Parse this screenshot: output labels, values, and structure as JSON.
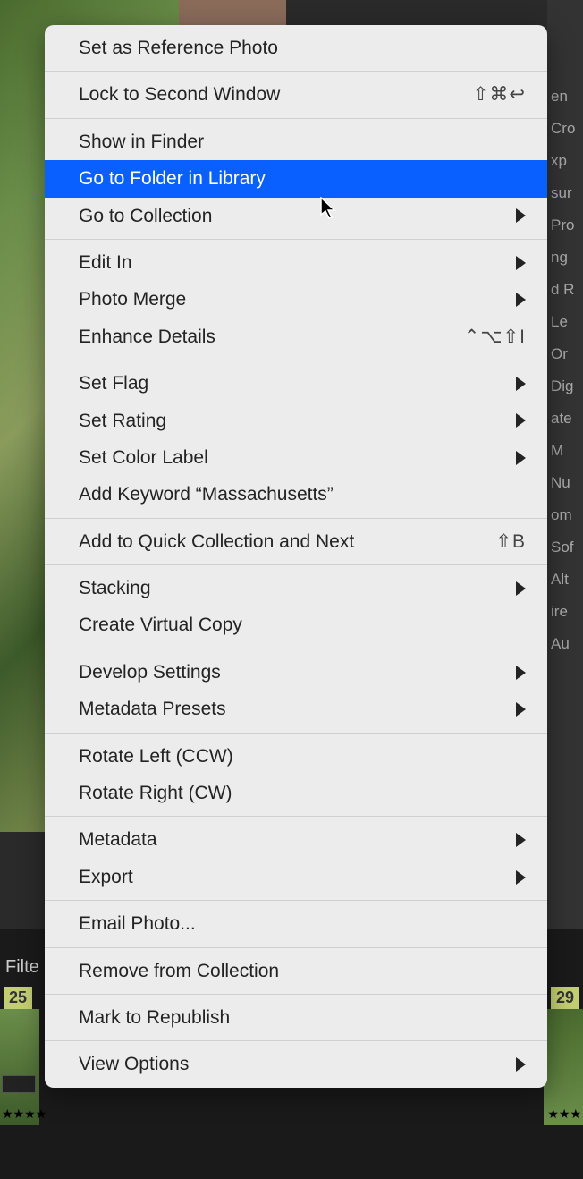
{
  "background": {
    "filter_label": "Filte",
    "thumb_left_num": "25",
    "thumb_right_num": "29",
    "stars_left": "★★★★",
    "stars_right": "★★★",
    "right_labels": [
      "en",
      "Cro",
      "xp",
      "sur",
      "Pro",
      "ng",
      "d R",
      "Le",
      "Or",
      "Dig",
      "ate",
      "M",
      "Nu",
      "om",
      "Sof",
      "Alt",
      "ire",
      "Au"
    ]
  },
  "menu": {
    "groups": [
      {
        "items": [
          {
            "label": "Set as Reference Photo",
            "shortcut": "",
            "submenu": false,
            "highlighted": false
          }
        ]
      },
      {
        "items": [
          {
            "label": "Lock to Second Window",
            "shortcut": "⇧⌘↩",
            "submenu": false,
            "highlighted": false
          }
        ]
      },
      {
        "items": [
          {
            "label": "Show in Finder",
            "shortcut": "",
            "submenu": false,
            "highlighted": false
          },
          {
            "label": "Go to Folder in Library",
            "shortcut": "",
            "submenu": false,
            "highlighted": true
          },
          {
            "label": "Go to Collection",
            "shortcut": "",
            "submenu": true,
            "highlighted": false
          }
        ]
      },
      {
        "items": [
          {
            "label": "Edit In",
            "shortcut": "",
            "submenu": true,
            "highlighted": false
          },
          {
            "label": "Photo Merge",
            "shortcut": "",
            "submenu": true,
            "highlighted": false
          },
          {
            "label": "Enhance Details",
            "shortcut": "⌃⌥⇧I",
            "submenu": false,
            "highlighted": false
          }
        ]
      },
      {
        "items": [
          {
            "label": "Set Flag",
            "shortcut": "",
            "submenu": true,
            "highlighted": false
          },
          {
            "label": "Set Rating",
            "shortcut": "",
            "submenu": true,
            "highlighted": false
          },
          {
            "label": "Set Color Label",
            "shortcut": "",
            "submenu": true,
            "highlighted": false
          },
          {
            "label": "Add Keyword “Massachusetts”",
            "shortcut": "",
            "submenu": false,
            "highlighted": false
          }
        ]
      },
      {
        "items": [
          {
            "label": "Add to Quick Collection and Next",
            "shortcut": "⇧B",
            "submenu": false,
            "highlighted": false
          }
        ]
      },
      {
        "items": [
          {
            "label": "Stacking",
            "shortcut": "",
            "submenu": true,
            "highlighted": false
          },
          {
            "label": "Create Virtual Copy",
            "shortcut": "",
            "submenu": false,
            "highlighted": false
          }
        ]
      },
      {
        "items": [
          {
            "label": "Develop Settings",
            "shortcut": "",
            "submenu": true,
            "highlighted": false
          },
          {
            "label": "Metadata Presets",
            "shortcut": "",
            "submenu": true,
            "highlighted": false
          }
        ]
      },
      {
        "items": [
          {
            "label": "Rotate Left (CCW)",
            "shortcut": "",
            "submenu": false,
            "highlighted": false
          },
          {
            "label": "Rotate Right (CW)",
            "shortcut": "",
            "submenu": false,
            "highlighted": false
          }
        ]
      },
      {
        "items": [
          {
            "label": "Metadata",
            "shortcut": "",
            "submenu": true,
            "highlighted": false
          },
          {
            "label": "Export",
            "shortcut": "",
            "submenu": true,
            "highlighted": false
          }
        ]
      },
      {
        "items": [
          {
            "label": "Email Photo...",
            "shortcut": "",
            "submenu": false,
            "highlighted": false
          }
        ]
      },
      {
        "items": [
          {
            "label": "Remove from Collection",
            "shortcut": "",
            "submenu": false,
            "highlighted": false
          }
        ]
      },
      {
        "items": [
          {
            "label": "Mark to Republish",
            "shortcut": "",
            "submenu": false,
            "highlighted": false
          }
        ]
      },
      {
        "items": [
          {
            "label": "View Options",
            "shortcut": "",
            "submenu": true,
            "highlighted": false
          }
        ]
      }
    ]
  }
}
